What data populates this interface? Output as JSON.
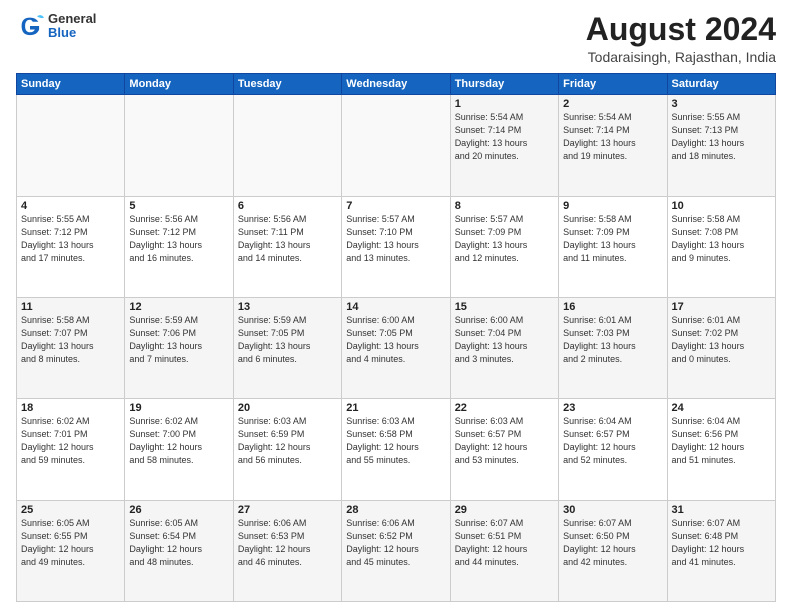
{
  "header": {
    "logo_general": "General",
    "logo_blue": "Blue",
    "title": "August 2024",
    "subtitle": "Todaraisingh, Rajasthan, India"
  },
  "days_of_week": [
    "Sunday",
    "Monday",
    "Tuesday",
    "Wednesday",
    "Thursday",
    "Friday",
    "Saturday"
  ],
  "weeks": [
    [
      {
        "day": "",
        "info": ""
      },
      {
        "day": "",
        "info": ""
      },
      {
        "day": "",
        "info": ""
      },
      {
        "day": "",
        "info": ""
      },
      {
        "day": "1",
        "info": "Sunrise: 5:54 AM\nSunset: 7:14 PM\nDaylight: 13 hours\nand 20 minutes."
      },
      {
        "day": "2",
        "info": "Sunrise: 5:54 AM\nSunset: 7:14 PM\nDaylight: 13 hours\nand 19 minutes."
      },
      {
        "day": "3",
        "info": "Sunrise: 5:55 AM\nSunset: 7:13 PM\nDaylight: 13 hours\nand 18 minutes."
      }
    ],
    [
      {
        "day": "4",
        "info": "Sunrise: 5:55 AM\nSunset: 7:12 PM\nDaylight: 13 hours\nand 17 minutes."
      },
      {
        "day": "5",
        "info": "Sunrise: 5:56 AM\nSunset: 7:12 PM\nDaylight: 13 hours\nand 16 minutes."
      },
      {
        "day": "6",
        "info": "Sunrise: 5:56 AM\nSunset: 7:11 PM\nDaylight: 13 hours\nand 14 minutes."
      },
      {
        "day": "7",
        "info": "Sunrise: 5:57 AM\nSunset: 7:10 PM\nDaylight: 13 hours\nand 13 minutes."
      },
      {
        "day": "8",
        "info": "Sunrise: 5:57 AM\nSunset: 7:09 PM\nDaylight: 13 hours\nand 12 minutes."
      },
      {
        "day": "9",
        "info": "Sunrise: 5:58 AM\nSunset: 7:09 PM\nDaylight: 13 hours\nand 11 minutes."
      },
      {
        "day": "10",
        "info": "Sunrise: 5:58 AM\nSunset: 7:08 PM\nDaylight: 13 hours\nand 9 minutes."
      }
    ],
    [
      {
        "day": "11",
        "info": "Sunrise: 5:58 AM\nSunset: 7:07 PM\nDaylight: 13 hours\nand 8 minutes."
      },
      {
        "day": "12",
        "info": "Sunrise: 5:59 AM\nSunset: 7:06 PM\nDaylight: 13 hours\nand 7 minutes."
      },
      {
        "day": "13",
        "info": "Sunrise: 5:59 AM\nSunset: 7:05 PM\nDaylight: 13 hours\nand 6 minutes."
      },
      {
        "day": "14",
        "info": "Sunrise: 6:00 AM\nSunset: 7:05 PM\nDaylight: 13 hours\nand 4 minutes."
      },
      {
        "day": "15",
        "info": "Sunrise: 6:00 AM\nSunset: 7:04 PM\nDaylight: 13 hours\nand 3 minutes."
      },
      {
        "day": "16",
        "info": "Sunrise: 6:01 AM\nSunset: 7:03 PM\nDaylight: 13 hours\nand 2 minutes."
      },
      {
        "day": "17",
        "info": "Sunrise: 6:01 AM\nSunset: 7:02 PM\nDaylight: 13 hours\nand 0 minutes."
      }
    ],
    [
      {
        "day": "18",
        "info": "Sunrise: 6:02 AM\nSunset: 7:01 PM\nDaylight: 12 hours\nand 59 minutes."
      },
      {
        "day": "19",
        "info": "Sunrise: 6:02 AM\nSunset: 7:00 PM\nDaylight: 12 hours\nand 58 minutes."
      },
      {
        "day": "20",
        "info": "Sunrise: 6:03 AM\nSunset: 6:59 PM\nDaylight: 12 hours\nand 56 minutes."
      },
      {
        "day": "21",
        "info": "Sunrise: 6:03 AM\nSunset: 6:58 PM\nDaylight: 12 hours\nand 55 minutes."
      },
      {
        "day": "22",
        "info": "Sunrise: 6:03 AM\nSunset: 6:57 PM\nDaylight: 12 hours\nand 53 minutes."
      },
      {
        "day": "23",
        "info": "Sunrise: 6:04 AM\nSunset: 6:57 PM\nDaylight: 12 hours\nand 52 minutes."
      },
      {
        "day": "24",
        "info": "Sunrise: 6:04 AM\nSunset: 6:56 PM\nDaylight: 12 hours\nand 51 minutes."
      }
    ],
    [
      {
        "day": "25",
        "info": "Sunrise: 6:05 AM\nSunset: 6:55 PM\nDaylight: 12 hours\nand 49 minutes."
      },
      {
        "day": "26",
        "info": "Sunrise: 6:05 AM\nSunset: 6:54 PM\nDaylight: 12 hours\nand 48 minutes."
      },
      {
        "day": "27",
        "info": "Sunrise: 6:06 AM\nSunset: 6:53 PM\nDaylight: 12 hours\nand 46 minutes."
      },
      {
        "day": "28",
        "info": "Sunrise: 6:06 AM\nSunset: 6:52 PM\nDaylight: 12 hours\nand 45 minutes."
      },
      {
        "day": "29",
        "info": "Sunrise: 6:07 AM\nSunset: 6:51 PM\nDaylight: 12 hours\nand 44 minutes."
      },
      {
        "day": "30",
        "info": "Sunrise: 6:07 AM\nSunset: 6:50 PM\nDaylight: 12 hours\nand 42 minutes."
      },
      {
        "day": "31",
        "info": "Sunrise: 6:07 AM\nSunset: 6:48 PM\nDaylight: 12 hours\nand 41 minutes."
      }
    ]
  ]
}
